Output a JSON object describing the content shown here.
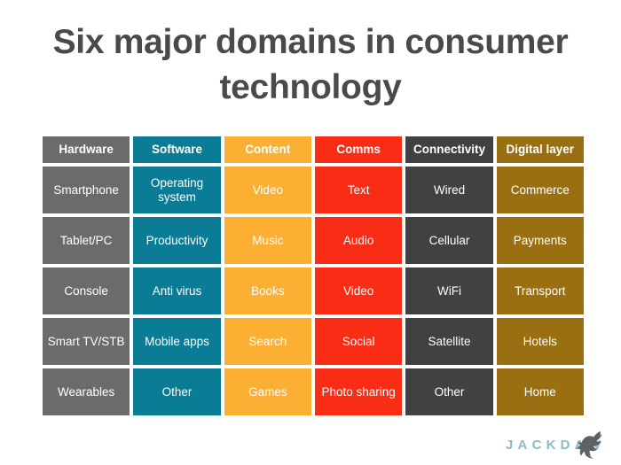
{
  "slide": {
    "title": "Six major domains in consumer technology"
  },
  "matrix": {
    "columns": [
      {
        "header": "Hardware",
        "color": "#6b6b6b",
        "items": [
          "Smartphone",
          "Tablet/PC",
          "Console",
          "Smart TV/STB",
          "Wearables"
        ]
      },
      {
        "header": "Software",
        "color": "#0a7c95",
        "items": [
          "Operating system",
          "Productivity",
          "Anti virus",
          "Mobile apps",
          "Other"
        ]
      },
      {
        "header": "Content",
        "color": "#fbb034",
        "items": [
          "Video",
          "Music",
          "Books",
          "Search",
          "Games"
        ]
      },
      {
        "header": "Comms",
        "color": "#f92c15",
        "items": [
          "Text",
          "Audio",
          "Video",
          "Social",
          "Photo sharing"
        ]
      },
      {
        "header": "Connectivity",
        "color": "#414141",
        "items": [
          "Wired",
          "Cellular",
          "WiFi",
          "Satellite",
          "Other"
        ]
      },
      {
        "header": "Digital layer",
        "color": "#9a6f11",
        "items": [
          "Commerce",
          "Payments",
          "Transport",
          "Hotels",
          "Home"
        ]
      }
    ]
  },
  "logo": {
    "wordmark": "JACKDAW",
    "wordmark_color": "#8fb8cc",
    "bird_color": "#5c6266",
    "bird_icon": "jackdaw-bird-icon"
  },
  "theme": {
    "title_color": "#4a4a4a",
    "background": "#ffffff",
    "cell_text_color": "#ffffff"
  }
}
